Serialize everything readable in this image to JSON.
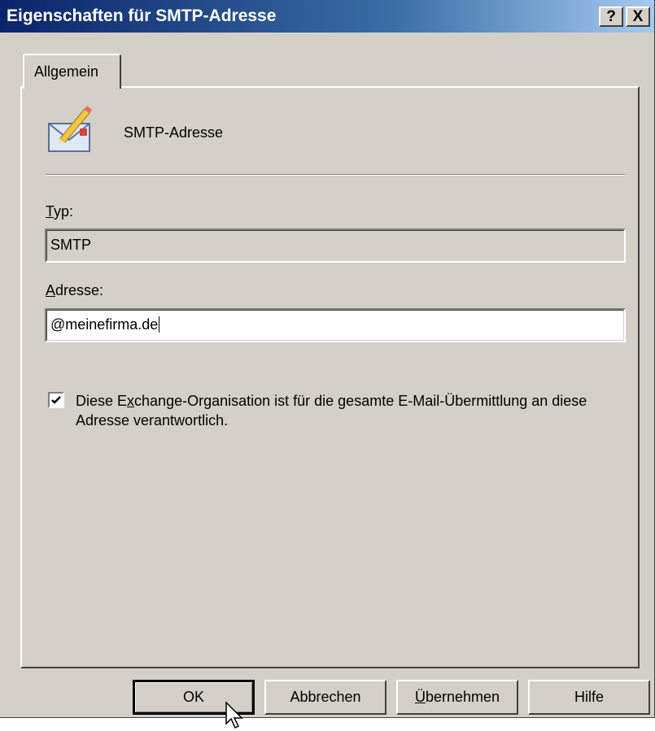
{
  "window": {
    "title": "Eigenschaften für SMTP-Adresse",
    "help_button_label": "?",
    "close_button_label": "X"
  },
  "tabs": [
    {
      "label": "Allgemein",
      "active": true
    }
  ],
  "general": {
    "heading_icon": "envelope-pencil-icon",
    "heading_text": "SMTP-Adresse",
    "type_label_accesskey": "T",
    "type_label_rest": "yp:",
    "type_value": "SMTP",
    "address_label_accesskey": "A",
    "address_label_rest": "dresse:",
    "address_value": "@meinefirma.de",
    "responsible_checkbox": {
      "checked": true,
      "text_before": "Diese E",
      "text_accesskey": "x",
      "text_after": "change-Organisation ist für die gesamte E-Mail-Übermittlung an diese Adresse verantwortlich."
    }
  },
  "buttons": {
    "ok_label": "OK",
    "cancel_label": "Abbrechen",
    "apply_accesskey": "Ü",
    "apply_rest": "bernehmen",
    "help_label": "Hilfe"
  },
  "colors": {
    "face": "#d4d0c8",
    "title_active_start": "#0a246a",
    "title_active_end": "#a6caf0"
  }
}
